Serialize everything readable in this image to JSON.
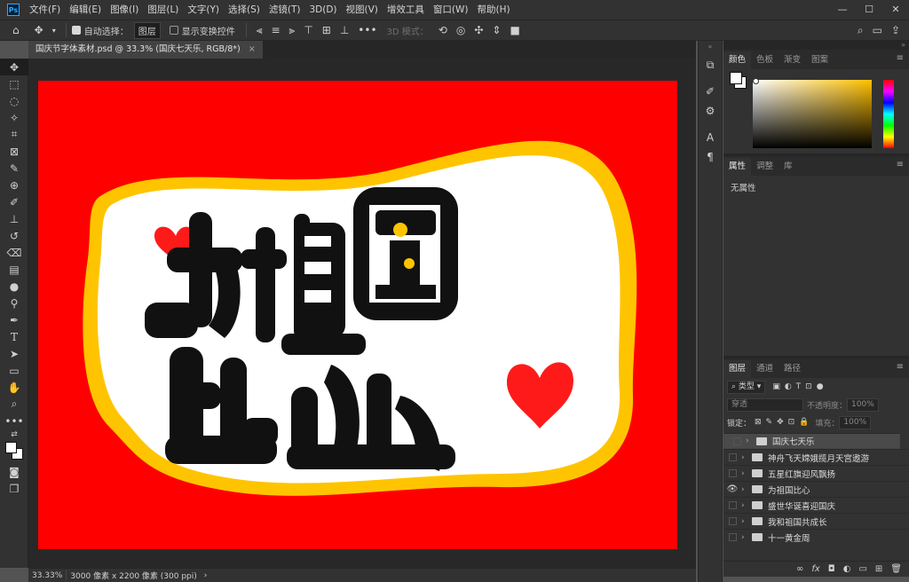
{
  "app": {
    "logo": "Ps"
  },
  "menu": [
    "文件(F)",
    "编辑(E)",
    "图像(I)",
    "图层(L)",
    "文字(Y)",
    "选择(S)",
    "滤镜(T)",
    "3D(D)",
    "视图(V)",
    "增效工具",
    "窗口(W)",
    "帮助(H)"
  ],
  "options": {
    "auto_select_label": "自动选择：",
    "auto_select_value": "图层",
    "show_transform_label": "显示变换控件",
    "mode_3d_label": "3D 模式："
  },
  "document": {
    "tab_title": "国庆节字体素材.psd @ 33.3% (国庆七天乐, RGB/8*)",
    "artwork_text": "为祖国比心",
    "zoom": "33.33%",
    "doc_info": "3000 像素 x 2200 像素 (300 ppi)",
    "bg_color": "#ff0000",
    "frame_color": "#ffc400"
  },
  "color_panel": {
    "tabs": [
      "颜色",
      "色板",
      "渐变",
      "图案"
    ],
    "hue": "#ffc000"
  },
  "properties_panel": {
    "tabs": [
      "属性",
      "调整",
      "库"
    ],
    "empty_text": "无属性"
  },
  "layers_panel": {
    "tabs": [
      "图层",
      "通道",
      "路径"
    ],
    "filter_label": "类型",
    "blend_mode": "穿透",
    "opacity_label": "不透明度：",
    "opacity_value": "100%",
    "lock_label": "锁定：",
    "fill_label": "填充：",
    "fill_value": "100%",
    "layers": [
      {
        "name": "国庆七天乐",
        "visible": false,
        "selected": true
      },
      {
        "name": "神舟飞天嫦娥揽月天宫遨游",
        "visible": false,
        "selected": false
      },
      {
        "name": "五星红旗迎风飘扬",
        "visible": false,
        "selected": false
      },
      {
        "name": "为祖国比心",
        "visible": true,
        "selected": false
      },
      {
        "name": "盛世华诞喜迎国庆",
        "visible": false,
        "selected": false
      },
      {
        "name": "我和祖国共成长",
        "visible": false,
        "selected": false
      },
      {
        "name": "十一黄金周",
        "visible": false,
        "selected": false
      }
    ]
  }
}
